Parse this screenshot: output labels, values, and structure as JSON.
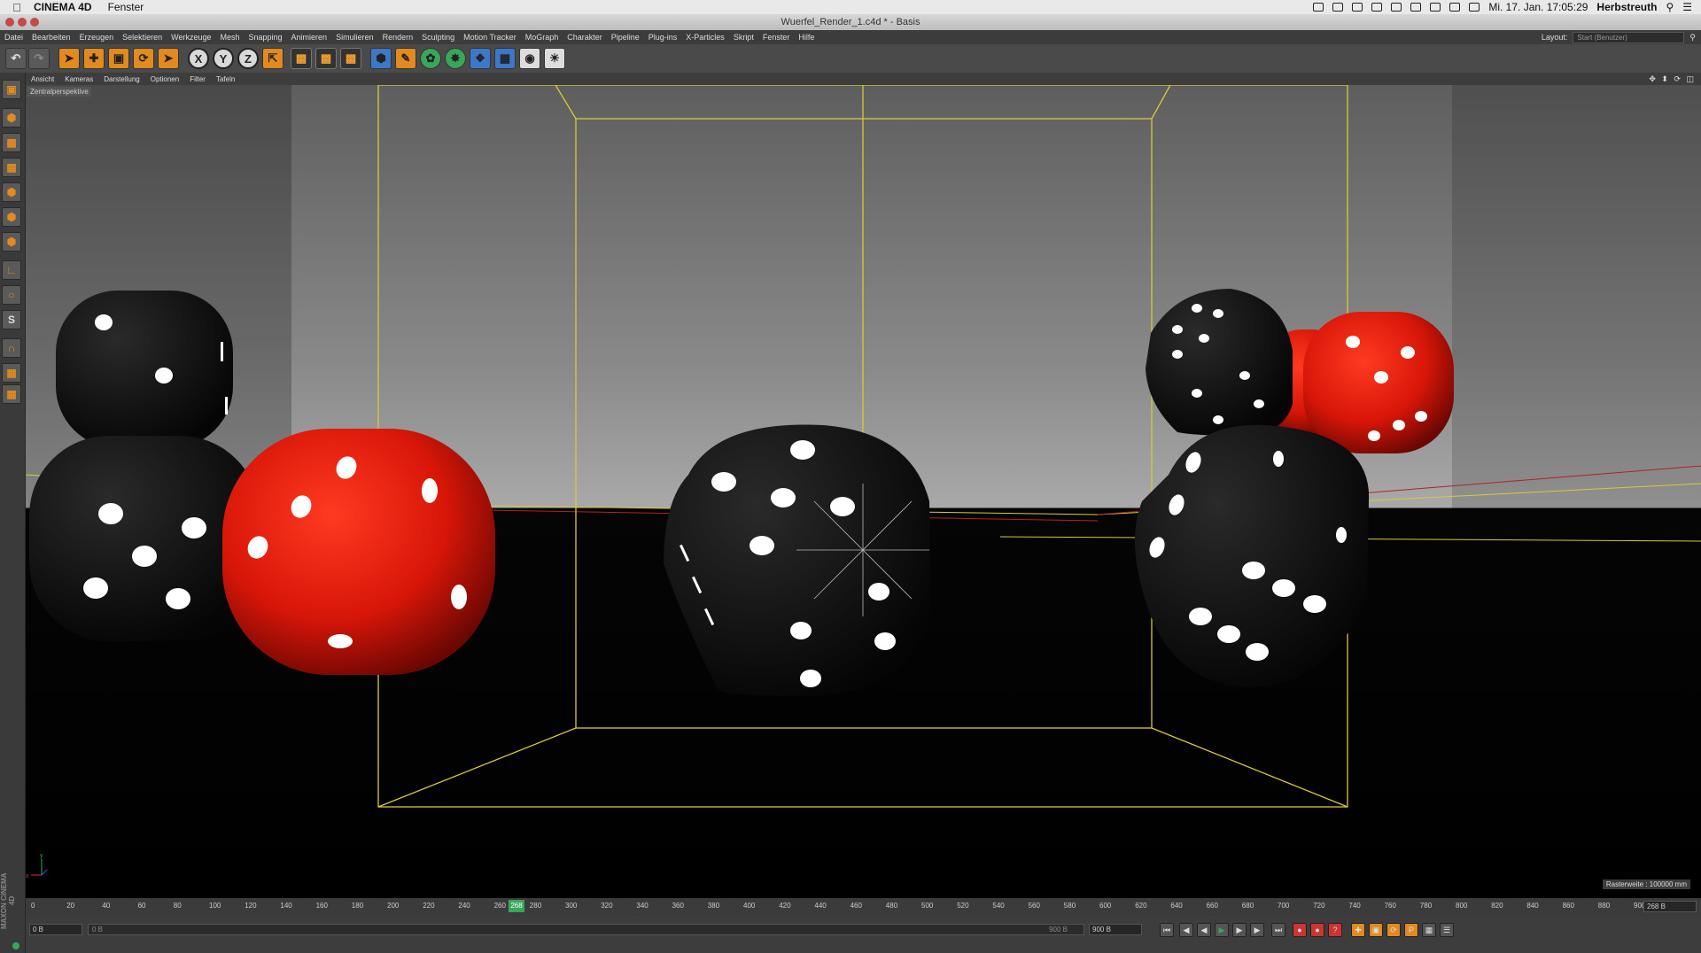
{
  "mac_menubar": {
    "app_name": "CINEMA 4D",
    "menu": "Fenster",
    "datetime": "Mi. 17. Jan.  17:05:29",
    "user": "Herbstreuth"
  },
  "window": {
    "title": "Wuerfel_Render_1.c4d * - Basis"
  },
  "menu": {
    "items": [
      "Datei",
      "Bearbeiten",
      "Erzeugen",
      "Selektieren",
      "Werkzeuge",
      "Mesh",
      "Snapping",
      "Animieren",
      "Simulieren",
      "Rendern",
      "Sculpting",
      "Motion Tracker",
      "MoGraph",
      "Charakter",
      "Pipeline",
      "Plug-ins",
      "X-Particles",
      "Skript",
      "Fenster",
      "Hilfe"
    ],
    "layout_label": "Layout:",
    "layout_value": "Start (Benutzer)"
  },
  "toolbar": {
    "axis_x": "X",
    "axis_y": "Y",
    "axis_z": "Z"
  },
  "left_toolbar": {
    "snap_label": "S"
  },
  "viewport_menu": {
    "items": [
      "Ansicht",
      "Kameras",
      "Darstellung",
      "Optionen",
      "Filter",
      "Tafeln"
    ],
    "icons": "✥ ⬍ ⟳ ◫"
  },
  "viewport": {
    "camera_label": "Zentralperspektive",
    "grid_spacing": "Rasterweite : 100000 mm",
    "axis_y_label": "y",
    "axis_x_label": "x"
  },
  "timeline": {
    "ticks": [
      "0",
      "20",
      "40",
      "60",
      "80",
      "100",
      "120",
      "140",
      "160",
      "180",
      "200",
      "220",
      "240",
      "260",
      "280",
      "300",
      "320",
      "340",
      "360",
      "380",
      "400",
      "420",
      "440",
      "460",
      "480",
      "500",
      "520",
      "540",
      "560",
      "580",
      "600",
      "620",
      "640",
      "660",
      "680",
      "700",
      "720",
      "740",
      "760",
      "780",
      "800",
      "820",
      "840",
      "860",
      "880",
      "900"
    ],
    "current_frame": "268",
    "frame_field": "268 B"
  },
  "bottom": {
    "start_field": "0 B",
    "min_field": "0 B",
    "max_field": "900 B",
    "end_field": "900 B"
  },
  "brand": {
    "maxon": "MAXON CINEMA 4D"
  },
  "colors": {
    "bbox": "#d9c93b",
    "red_die": "#e31b0f",
    "accent_orange": "#e38a1f"
  }
}
